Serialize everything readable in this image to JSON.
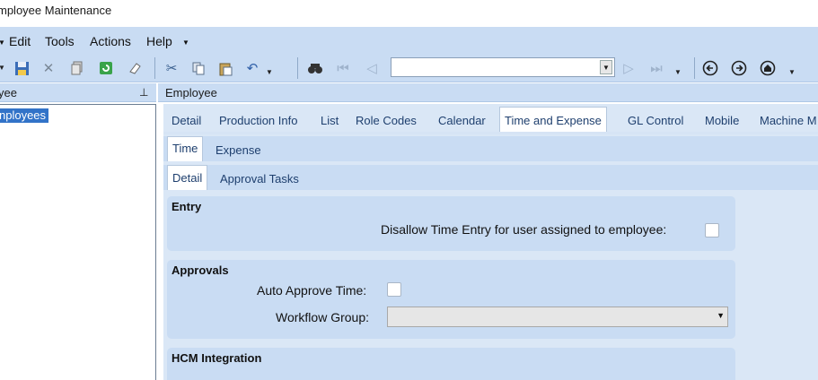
{
  "window": {
    "title": "mployee Maintenance"
  },
  "menu": {
    "items": [
      "Edit",
      "Tools",
      "Actions",
      "Help"
    ]
  },
  "toolbar": {
    "icons": [
      "save-icon",
      "delete-icon",
      "copy-icon",
      "refresh-icon",
      "clear-icon",
      "cut-icon",
      "copy-clipboard-icon",
      "paste-icon",
      "undo-icon",
      "find-icon",
      "first-icon",
      "previous-icon",
      "next-icon",
      "last-icon",
      "back-icon",
      "forward-icon",
      "home-icon"
    ],
    "nav_value": ""
  },
  "left_panel": {
    "header": "yee",
    "tree_selected": "nployees"
  },
  "right_panel": {
    "header": "Employee"
  },
  "tabs": {
    "main": [
      "Detail",
      "Production Info",
      "List",
      "Role Codes",
      "Calendar",
      "Time and Expense",
      "GL Control",
      "Mobile",
      "Machine M"
    ],
    "main_active": "Time and Expense",
    "sub": [
      "Time",
      "Expense"
    ],
    "sub_active": "Time",
    "sub2": [
      "Detail",
      "Approval Tasks"
    ],
    "sub2_active": "Detail"
  },
  "sections": {
    "entry": {
      "title": "Entry",
      "disallow_label": "Disallow Time Entry for user assigned to employee:",
      "disallow_checked": false
    },
    "approvals": {
      "title": "Approvals",
      "auto_approve_label": "Auto Approve Time:",
      "auto_approve_checked": false,
      "workflow_label": "Workflow Group:",
      "workflow_value": ""
    },
    "hcm": {
      "title": "HCM Integration"
    }
  },
  "colors": {
    "accent": "#3273c8",
    "bar": "#c9dcf3",
    "panel": "#dae7f6",
    "tab_text": "#1e3f6e"
  }
}
